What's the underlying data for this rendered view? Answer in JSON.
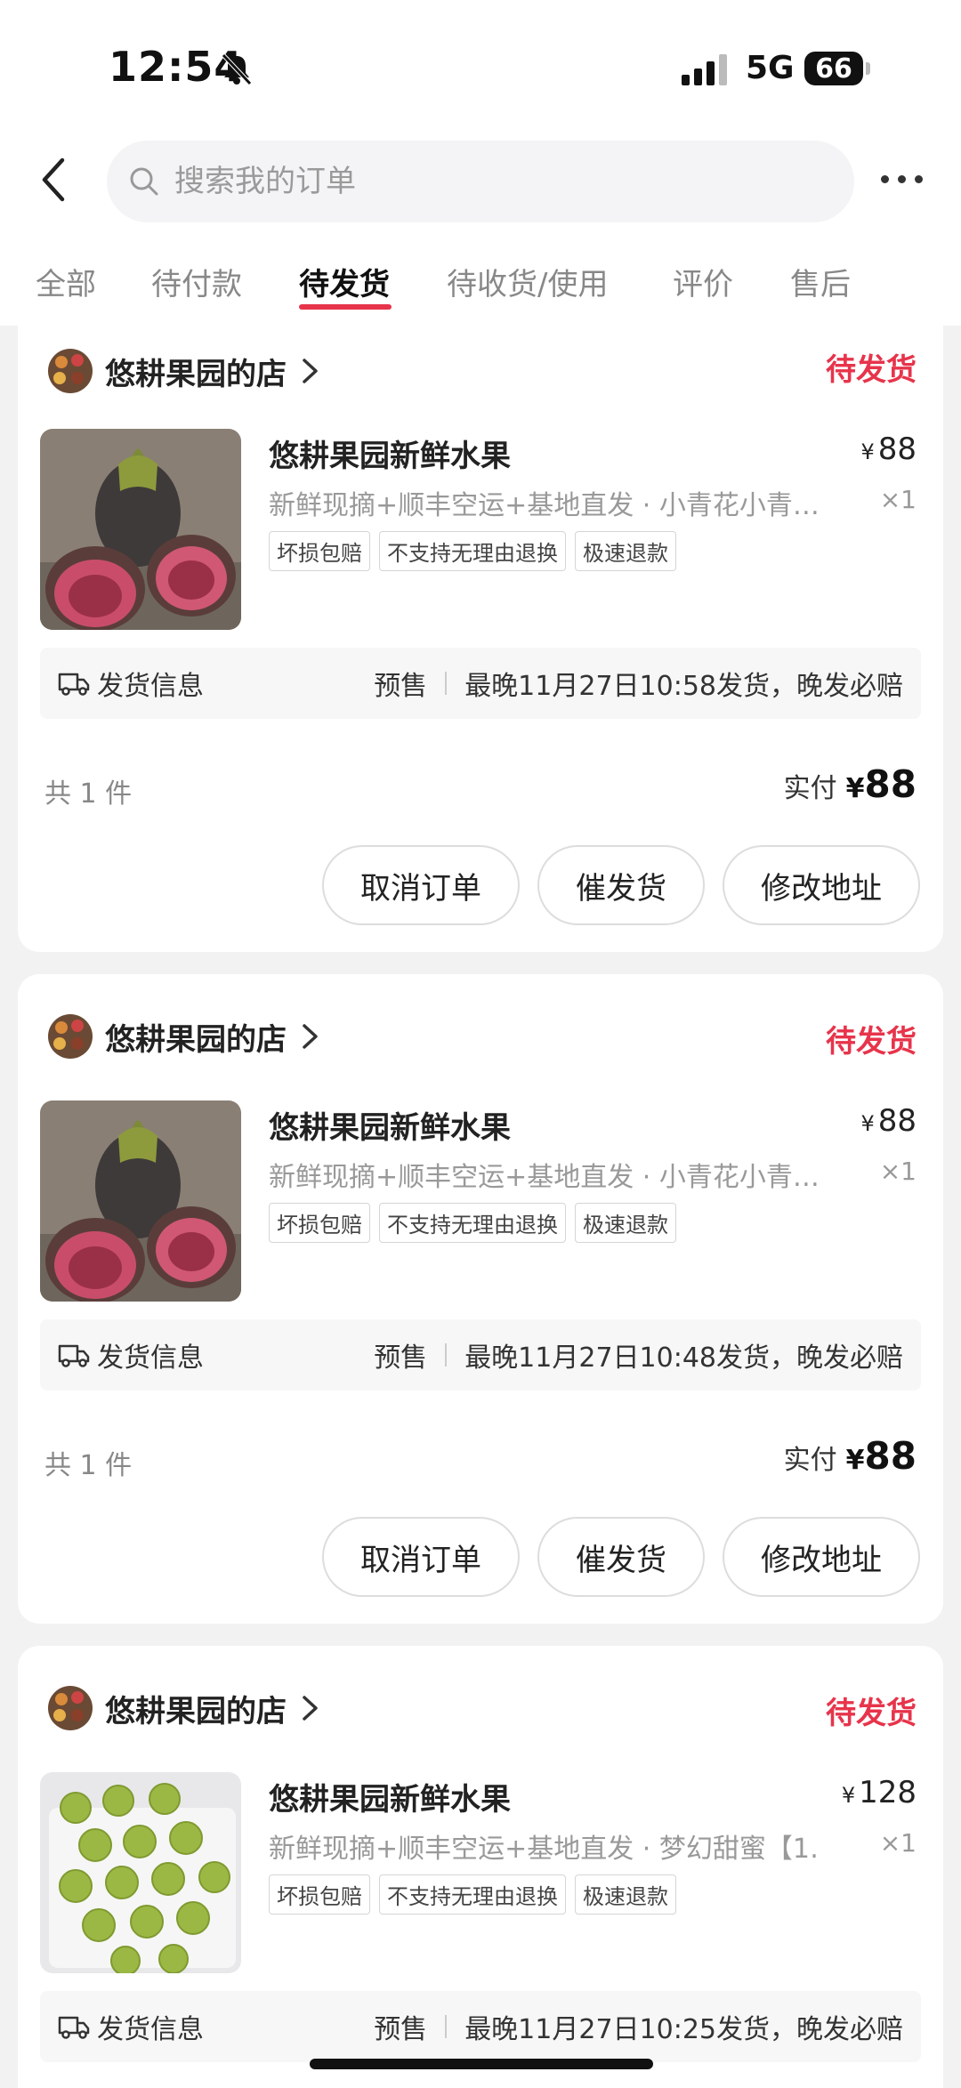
{
  "status_bar": {
    "time": "12:54",
    "network": "5G",
    "battery": "66"
  },
  "search": {
    "placeholder": "搜索我的订单"
  },
  "tabs": [
    {
      "label": "全部"
    },
    {
      "label": "待付款"
    },
    {
      "label": "待发货",
      "active": true
    },
    {
      "label": "待收货/使用"
    },
    {
      "label": "评价"
    },
    {
      "label": "售后"
    }
  ],
  "orders": [
    {
      "shop_name": "悠耕果园的店",
      "status": "待发货",
      "product_title": "悠耕果园新鲜水果",
      "price": "88",
      "spec": "新鲜现摘+顺丰空运+基地直发 · 小青花小青…",
      "qty": "×1",
      "tags": [
        "坏损包赔",
        "不支持无理由退换",
        "极速退款"
      ],
      "ship_label": "发货信息",
      "ship_type": "预售",
      "ship_deadline": "最晚11月27日10:58发货，晚发必赔",
      "count": "共 1 件",
      "paid_label": "实付",
      "paid_amount": "88",
      "buttons": [
        "取消订单",
        "催发货",
        "修改地址"
      ]
    },
    {
      "shop_name": "悠耕果园的店",
      "status": "待发货",
      "product_title": "悠耕果园新鲜水果",
      "price": "88",
      "spec": "新鲜现摘+顺丰空运+基地直发 · 小青花小青…",
      "qty": "×1",
      "tags": [
        "坏损包赔",
        "不支持无理由退换",
        "极速退款"
      ],
      "ship_label": "发货信息",
      "ship_type": "预售",
      "ship_deadline": "最晚11月27日10:48发货，晚发必赔",
      "count": "共 1 件",
      "paid_label": "实付",
      "paid_amount": "88",
      "buttons": [
        "取消订单",
        "催发货",
        "修改地址"
      ]
    },
    {
      "shop_name": "悠耕果园的店",
      "status": "待发货",
      "product_title": "悠耕果园新鲜水果",
      "price": "128",
      "spec": "新鲜现摘+顺丰空运+基地直发 · 梦幻甜蜜【1…",
      "qty": "×1",
      "tags": [
        "坏损包赔",
        "不支持无理由退换",
        "极速退款"
      ],
      "ship_label": "发货信息",
      "ship_type": "预售",
      "ship_deadline": "最晚11月27日10:25发货，晚发必赔"
    }
  ],
  "currency_symbol": "¥",
  "colors": {
    "accent": "#e7344b",
    "background": "#f2f2f2"
  }
}
